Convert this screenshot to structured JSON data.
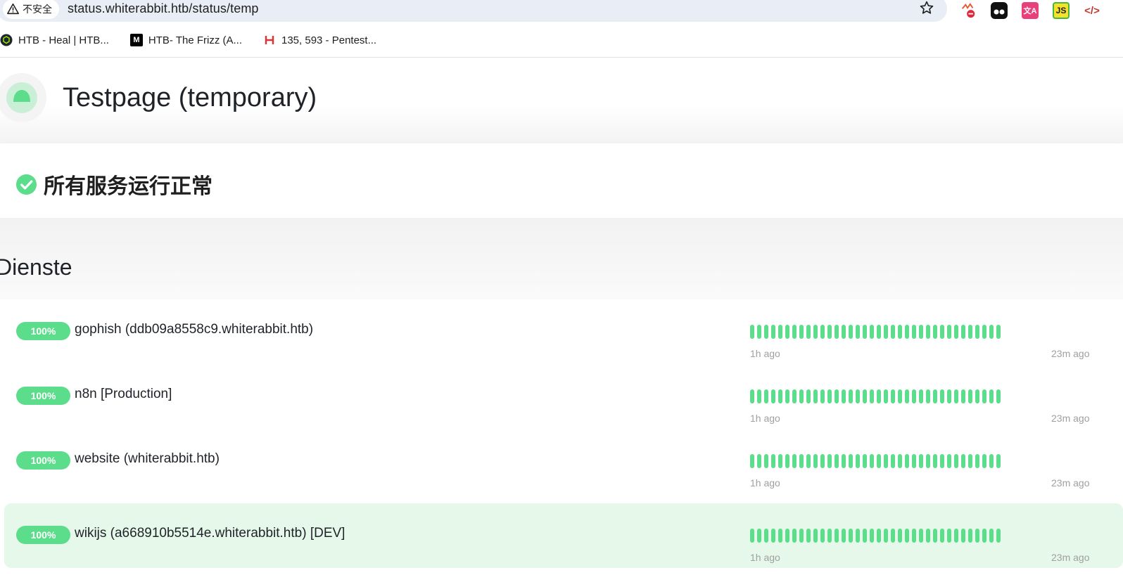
{
  "browser": {
    "security_label": "不安全",
    "url": "status.whiterabbit.htb/status/temp",
    "bookmarks": [
      {
        "label": "HTB - Heal | HTB..."
      },
      {
        "label": "HTB- The Frizz (A..."
      },
      {
        "label": "135, 593 - Pentest..."
      }
    ],
    "extensions": [
      "ublock-icon",
      "tampermonkey-icon",
      "translate-icon",
      "js-icon",
      "devtools-icon"
    ]
  },
  "header": {
    "title": "Testpage (temporary)"
  },
  "overall_status": {
    "text": "所有服务运行正常",
    "color": "#5cdd8b"
  },
  "section": {
    "title": "Dienste"
  },
  "monitors": [
    {
      "uptime": "100%",
      "name": "gophish (ddb09a8558c9.whiterabbit.htb)",
      "time_start": "1h ago",
      "time_end": "23m ago",
      "heartbeats": 36,
      "status": "up"
    },
    {
      "uptime": "100%",
      "name": "n8n [Production]",
      "time_start": "1h ago",
      "time_end": "23m ago",
      "heartbeats": 36,
      "status": "up"
    },
    {
      "uptime": "100%",
      "name": "website (whiterabbit.htb)",
      "time_start": "1h ago",
      "time_end": "23m ago",
      "heartbeats": 36,
      "status": "up"
    },
    {
      "uptime": "100%",
      "name": "wikijs (a668910b5514e.whiterabbit.htb) [DEV]",
      "time_start": "1h ago",
      "time_end": "23m ago",
      "heartbeats": 36,
      "status": "up"
    }
  ],
  "colors": {
    "up": "#5cdd8b",
    "highlight_row": "#e6f8ea"
  }
}
